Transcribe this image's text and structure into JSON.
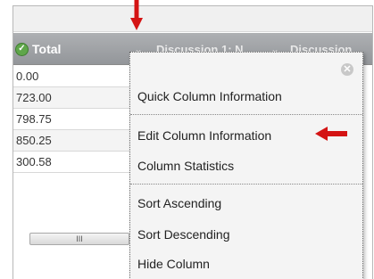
{
  "header": {
    "total_label": "Total",
    "discussion1_label": "Discussion 1: N",
    "discussion2_label": "Discussion"
  },
  "rows": [
    "0.00",
    "723.00",
    "798.75",
    "850.25",
    "300.58"
  ],
  "scrollbar": {
    "grip": "III"
  },
  "menu": {
    "close_glyph": "✕",
    "items": [
      "Quick Column Information",
      "Edit Column Information",
      "Column Statistics",
      "Sort Ascending",
      "Sort Descending",
      "Hide Column"
    ]
  },
  "icons": {
    "check": "check-circle-icon",
    "chevron": "chevron-down-icon",
    "close": "close-icon",
    "arrow_down": "red-arrow-down-icon",
    "arrow_left": "red-arrow-left-icon"
  },
  "colors": {
    "header_bg": "#9c9fa3",
    "menu_bg": "#f4f4f4",
    "accent_red": "#d41414",
    "check_green": "#5fa64a"
  }
}
